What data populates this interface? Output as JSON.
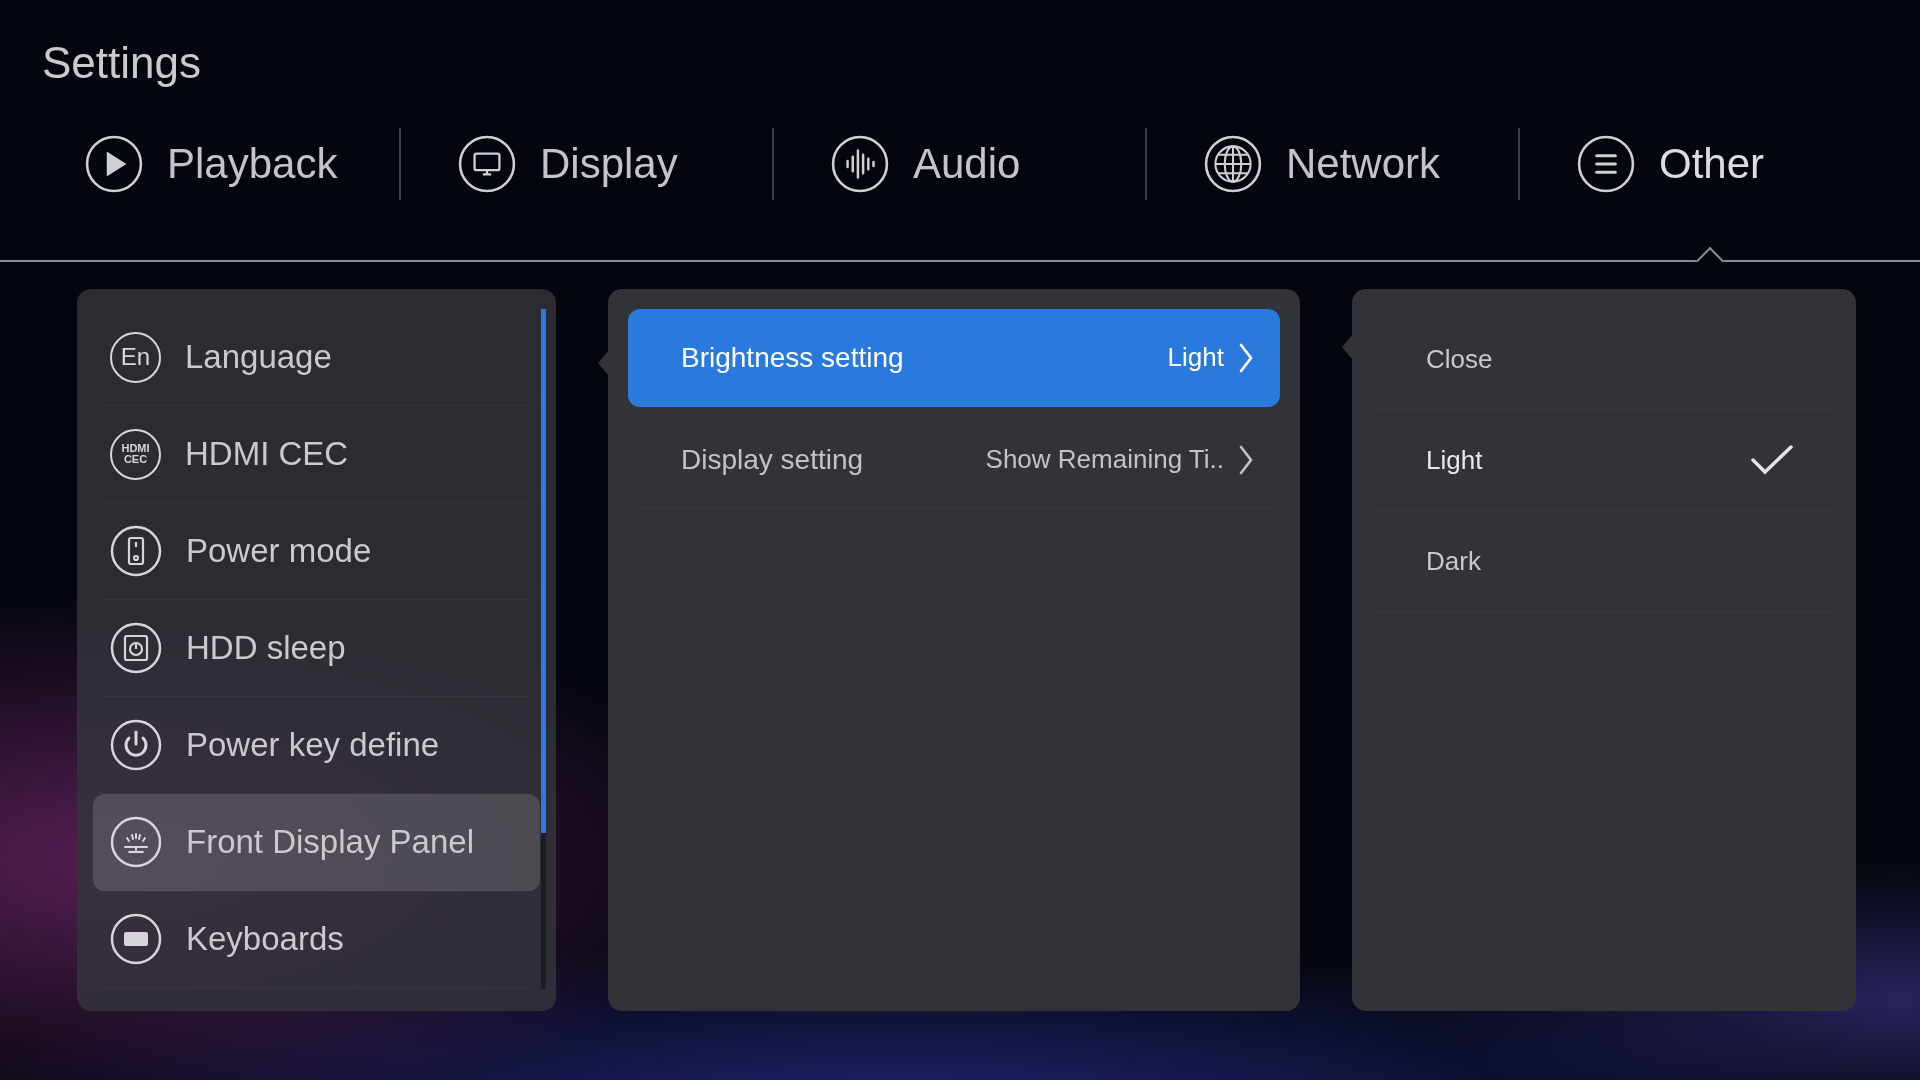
{
  "title": "Settings",
  "tabs": [
    {
      "label": "Playback",
      "selected": false
    },
    {
      "label": "Display",
      "selected": false
    },
    {
      "label": "Audio",
      "selected": false
    },
    {
      "label": "Network",
      "selected": false
    },
    {
      "label": "Other",
      "selected": true
    }
  ],
  "sidebar": {
    "items": [
      {
        "label": "Language",
        "icon_text": [
          "En"
        ],
        "selected": false
      },
      {
        "label": "HDMI CEC",
        "icon_text": [
          "HDMI",
          "CEC"
        ],
        "selected": false
      },
      {
        "label": "Power mode",
        "selected": false
      },
      {
        "label": "HDD sleep",
        "selected": false
      },
      {
        "label": "Power key define",
        "selected": false
      },
      {
        "label": "Front Display Panel",
        "selected": true
      },
      {
        "label": "Keyboards",
        "selected": false
      }
    ]
  },
  "settings": [
    {
      "label": "Brightness setting",
      "value": "Light",
      "selected": true
    },
    {
      "label": "Display setting",
      "value": "Show Remaining Ti..",
      "selected": false
    }
  ],
  "options": [
    {
      "label": "Close",
      "selected": false
    },
    {
      "label": "Light",
      "selected": true
    },
    {
      "label": "Dark",
      "selected": false
    }
  ]
}
